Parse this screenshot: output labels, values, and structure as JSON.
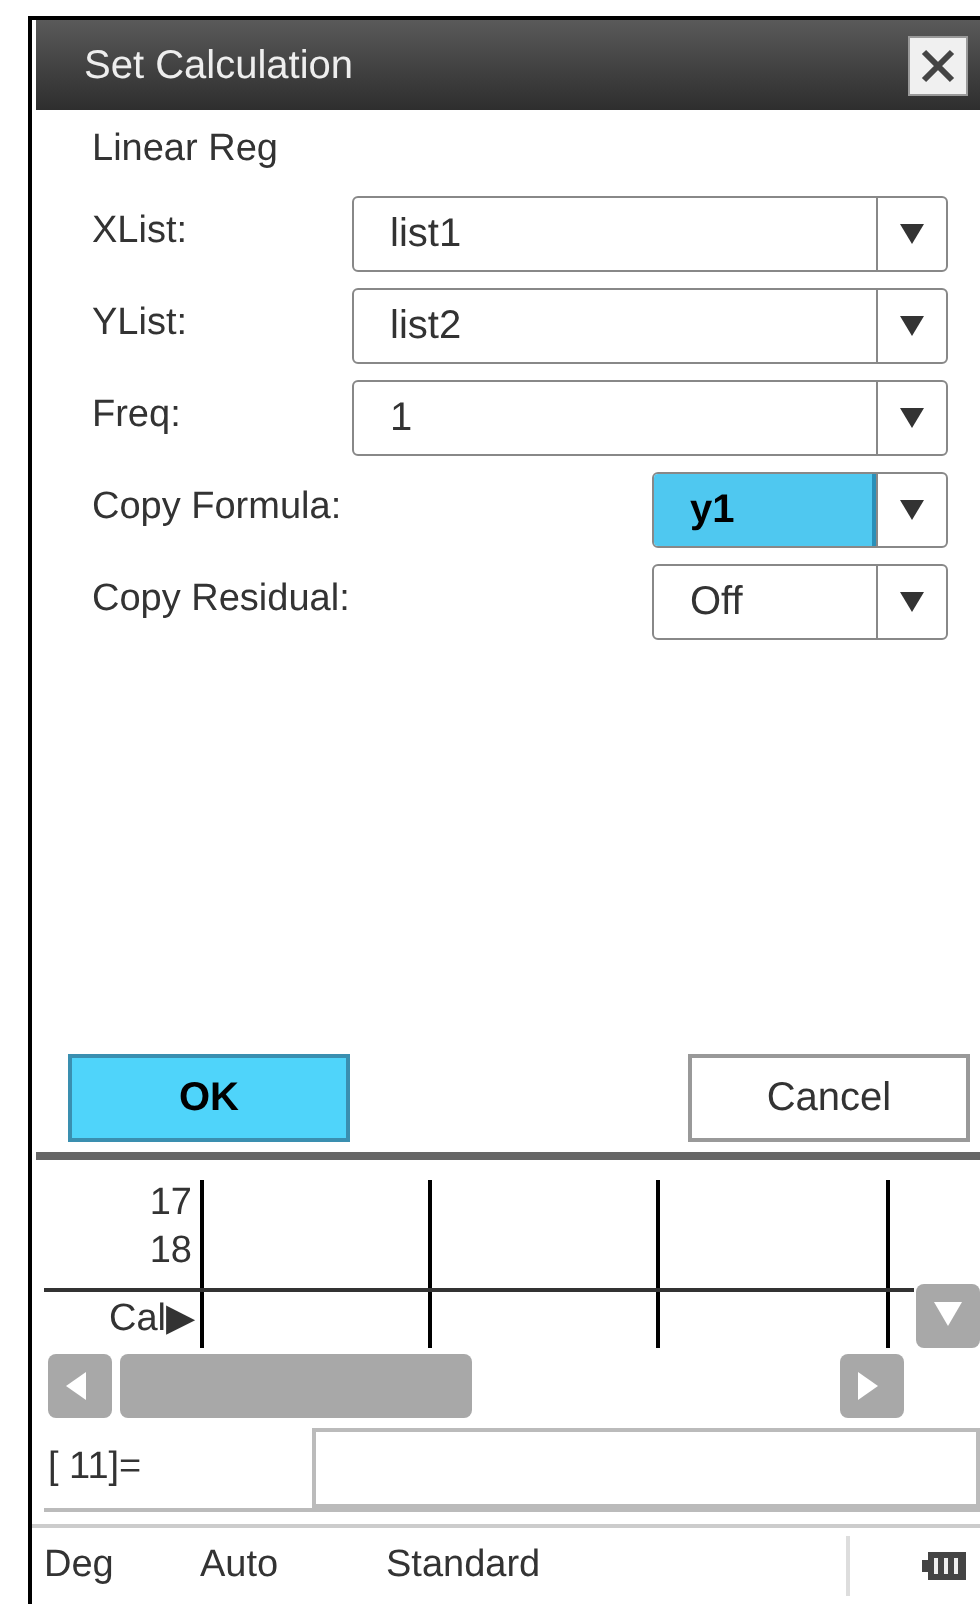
{
  "dialog": {
    "title": "Set Calculation",
    "subtitle": "Linear Reg",
    "fields": [
      {
        "label": "XList:",
        "value": "list1",
        "kind": "wide",
        "selected": false
      },
      {
        "label": "YList:",
        "value": "list2",
        "kind": "wide",
        "selected": false
      },
      {
        "label": "Freq:",
        "value": "1",
        "kind": "wide",
        "selected": false
      },
      {
        "label": "Copy Formula:",
        "value": "y1",
        "kind": "short",
        "selected": true
      },
      {
        "label": "Copy Residual:",
        "value": "Off",
        "kind": "short",
        "selected": false
      }
    ],
    "buttons": [
      {
        "label": "OK",
        "selected": true
      },
      {
        "label": "Cancel",
        "selected": false
      }
    ]
  },
  "sheet": {
    "row_numbers": [
      "17",
      "18"
    ],
    "footer_label": "Cal▶"
  },
  "entry": {
    "prompt": "[ 11]="
  },
  "status_bar": [
    "Deg",
    "Auto",
    "Standard"
  ]
}
